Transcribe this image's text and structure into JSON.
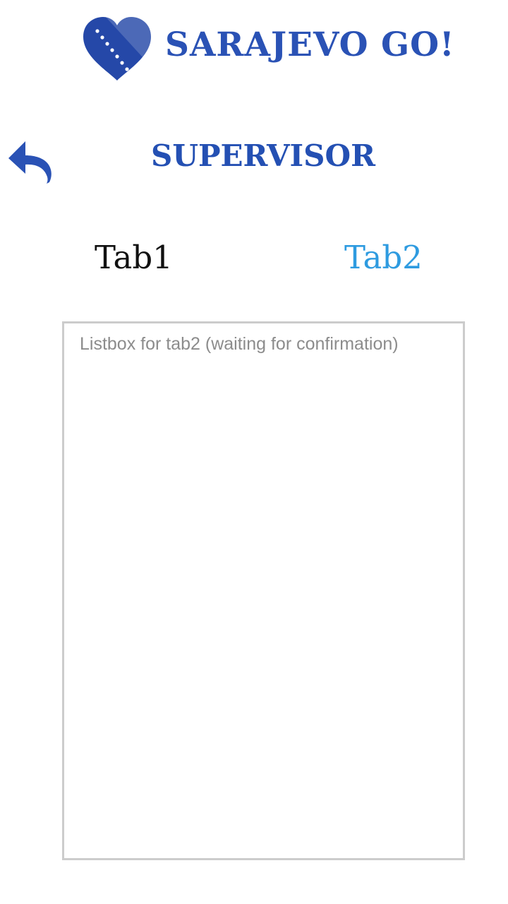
{
  "header": {
    "logo_text": "SARAJEVO GO!",
    "logo_icon": "heart-flag-icon"
  },
  "nav": {
    "back_icon": "reply-arrow-icon"
  },
  "page": {
    "title": "SUPERVISOR"
  },
  "tabs": [
    {
      "label": "Tab1",
      "active": false
    },
    {
      "label": "Tab2",
      "active": true
    }
  ],
  "listbox": {
    "placeholder": "Listbox for tab2 (waiting for confirmation)",
    "items": []
  },
  "colors": {
    "brand_blue": "#2a52b5",
    "active_tab": "#2e9be0",
    "inactive_tab": "#111111",
    "border": "#cccccc",
    "placeholder": "#8c8c8c"
  }
}
